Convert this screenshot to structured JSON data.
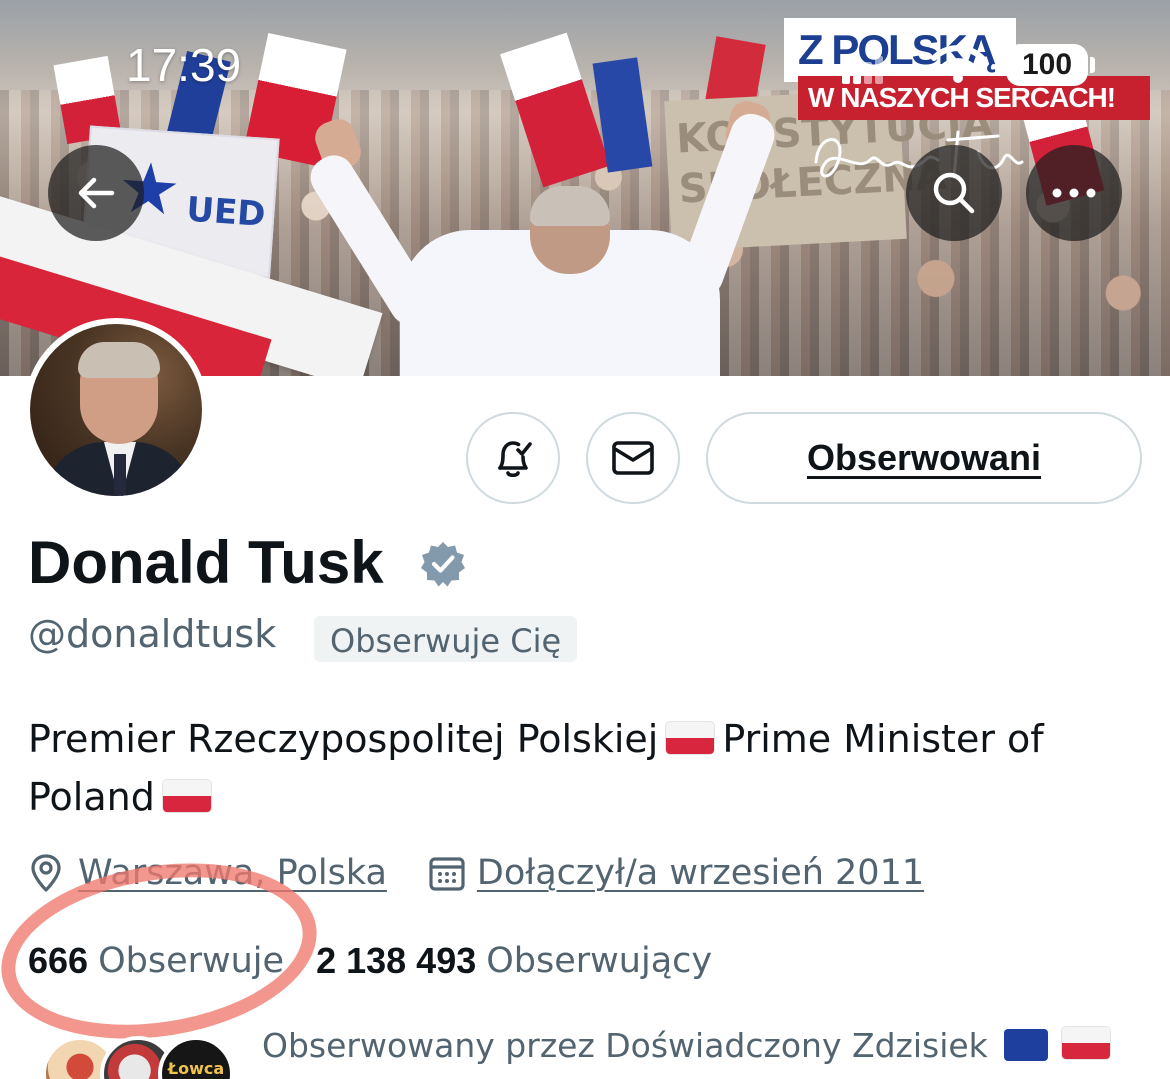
{
  "status_bar": {
    "time": "17:39",
    "battery": "100"
  },
  "banner": {
    "logo_line1": "Z POLSKĄ",
    "logo_line2": "W NASZYCH SERCACH!",
    "sign_text": "UED",
    "sign2_line1": "KONSTYTUCJA",
    "sign2_line2": "SPOŁECZNA"
  },
  "nav": {
    "back_icon": "arrow-left-icon",
    "search_icon": "search-icon",
    "more_icon": "more-horizontal-icon"
  },
  "actions": {
    "notify_icon": "bell-check-icon",
    "message_icon": "envelope-icon",
    "following_label": "Obserwowani"
  },
  "profile": {
    "name": "Donald Tusk",
    "handle": "@donaldtusk",
    "follows_you": "Obserwuje Cię",
    "bio_part1": "Premier Rzeczypospolitej Polskiej",
    "bio_part2": "Prime Minister of Poland",
    "location": "Warszawa, Polska",
    "joined": "Dołączył/a wrzesień 2011",
    "following_count": "666",
    "following_label": "Obserwuje",
    "followers_count": "2 138 493",
    "followers_label": "Obserwujący",
    "followed_by": "Obserwowany przez Doświadczony Zdzisiek"
  },
  "mini_avatars": {
    "third_text": "Łowca roidów"
  },
  "colors": {
    "text_primary": "#0f1419",
    "text_secondary": "#536471",
    "border": "#cfd9de",
    "verified": "#829aab",
    "highlight": "#f0786e"
  }
}
